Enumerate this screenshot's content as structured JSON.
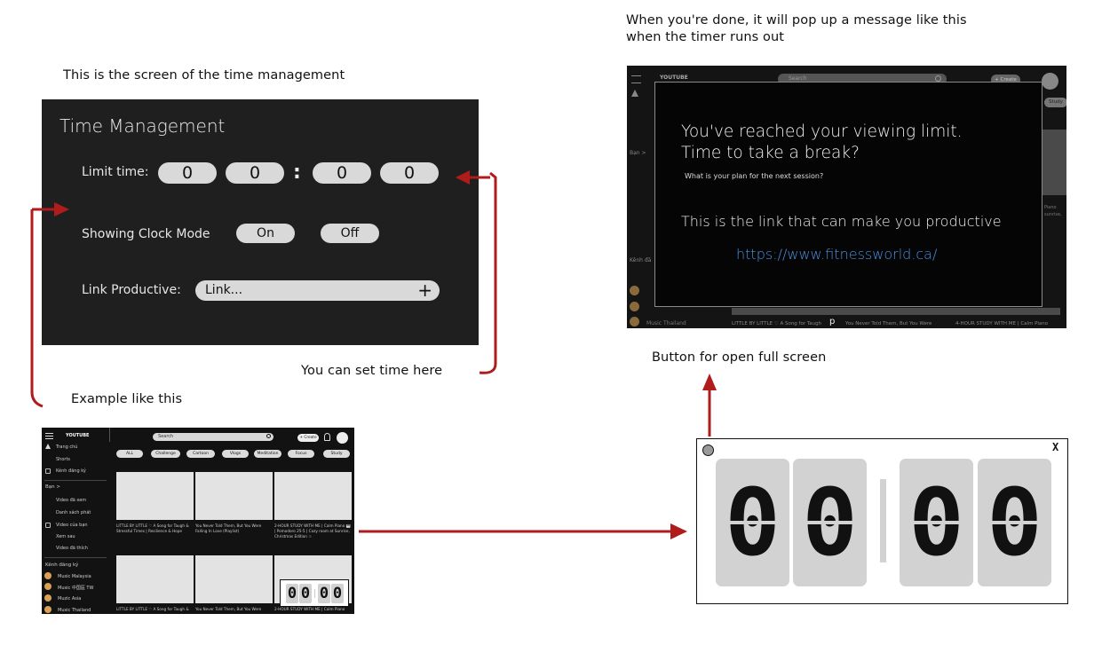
{
  "notes": {
    "popup_caption": "When you're done, it will pop up a message like this when the timer runs out",
    "popup_caption_line1": "When you're done, it will pop up a message like this",
    "popup_caption_line2": "when the timer runs out",
    "tm_caption": "This is the screen of the time management",
    "set_time": "You can set time here",
    "example": "Example like this",
    "fullscreen_button": "Button for open full screen"
  },
  "time_management": {
    "title": "Time Management",
    "limit_label": "Limit time:",
    "digits": [
      "0",
      "0",
      "0",
      "0"
    ],
    "separator": ":",
    "clock_mode_label": "Showing Clock Mode",
    "on_label": "On",
    "off_label": "Off",
    "link_label": "Link Productive:",
    "link_placeholder": "Link...",
    "add_symbol": "+"
  },
  "example_screen": {
    "brand": "YOUTUBE",
    "search_placeholder": "Search",
    "create_label": "+ Create",
    "sidebar": {
      "top": [
        "Trang chủ",
        "Shorts",
        "Kênh đăng ký"
      ],
      "you_header": "Bạn  >",
      "you_items": [
        "Video đã xem",
        "Danh sách phát",
        "Video của bạn",
        "Xem sau",
        "Video đã thích"
      ],
      "subs_header": "Kênh đăng ký",
      "subs": [
        "Music Malaysia",
        "Music 中国區 TW",
        "Muzic Asia",
        "Music Thailand"
      ]
    },
    "chips": [
      "ALL",
      "Challenge",
      "Cartoon",
      "Vlogs",
      "Meditation",
      "Focus",
      "Study"
    ],
    "captions": [
      "LITTLE BY LITTLE ♡ A Song for Taugh & Stressful Times | Resilience & Hope",
      "You Never Told Them, But You Were Falling In Love (Playlist)",
      "2-HOUR STUDY WITH ME | Calm Piano 🎹 | Pomodoro 25-5 | Cozy room at Sunrise, Christmas Edition ☃"
    ],
    "captions_bottom": [
      "LITTLE BY LITTLE ♡ A Song for Taugh &",
      "You Never Told Them, But You Were",
      "2-HOUR STUDY WITH ME | Calm Piano"
    ],
    "mini_timer": [
      "0",
      "0",
      "0",
      "0"
    ]
  },
  "popup_screen": {
    "brand": "YOUTUBE",
    "search_placeholder": "Search",
    "create_label": "+ Create",
    "study_chip": "Study",
    "line1": "You've reached your viewing limit.",
    "line2": "Time to take a break?",
    "question": "What is your plan for the next session?",
    "link_intro": "This is the link that can make you productive",
    "link_url": "https://www.fitnessworld.ca/",
    "sidebar_you": "Bạn  >",
    "sidebar_subs": "Kênh đă",
    "sub_last": "Music Thailand",
    "bottom_caption_1": "LITTLE BY LITTLE ♡ A Song for Taugh",
    "bottom_caption_2": "You Never Told Them, But You Were",
    "bottom_caption_3": "4-HOUR STUDY WITH ME | Calm Piano",
    "side_right_1": "Piano",
    "side_right_2": "sunrise,",
    "cursor_letter": "p"
  },
  "timer": {
    "digits": [
      "0",
      "0",
      "0",
      "0"
    ],
    "close_label": "X"
  },
  "colors": {
    "arrow": "#b01b1b",
    "panel_bg": "#1f1f1f",
    "pill_bg": "#d9d9d9",
    "link_blue": "#4a90e2"
  }
}
